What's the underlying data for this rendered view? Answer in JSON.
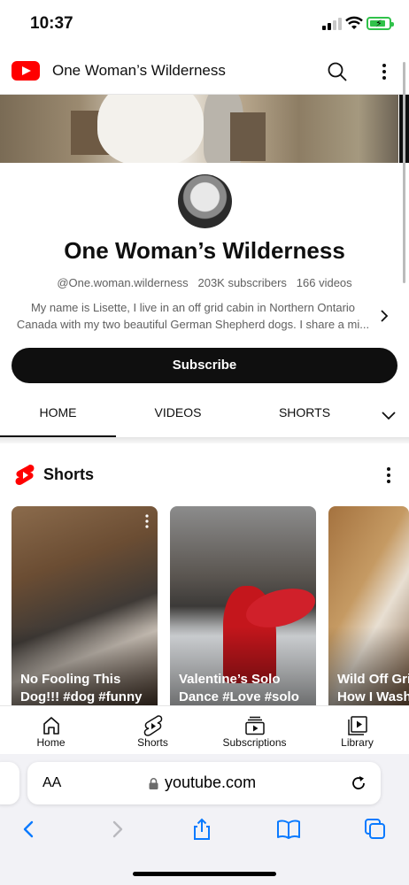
{
  "status_bar": {
    "time": "10:37"
  },
  "app_bar": {
    "title": "One Woman’s Wilderness"
  },
  "channel": {
    "name": "One Woman’s Wilderness",
    "handle": "@One.woman.wilderness",
    "subscribers": "203K subscribers",
    "videos": "166 videos",
    "description_line1": "My name is Lisette, I live in an off grid cabin in Northern Ontario",
    "description_line2": "Canada with my two beautiful German Shepherd dogs. I share a mi...",
    "subscribe_label": "Subscribe"
  },
  "tabs": [
    {
      "label": "HOME",
      "active": true
    },
    {
      "label": "VIDEOS",
      "active": false
    },
    {
      "label": "SHORTS",
      "active": false
    }
  ],
  "shorts_shelf": {
    "title": "Shorts",
    "items": [
      {
        "line1": "No Fooling This",
        "line2": "Dog!!! #dog #funny"
      },
      {
        "line1": "Valentine’s Solo",
        "line2": "Dance #Love #solo"
      },
      {
        "line1": "Wild Off Gri",
        "line2": "How I Wash"
      }
    ]
  },
  "bottom_nav": [
    {
      "label": "Home",
      "icon": "home-icon"
    },
    {
      "label": "Shorts",
      "icon": "shorts-icon"
    },
    {
      "label": "Subscriptions",
      "icon": "subscriptions-icon"
    },
    {
      "label": "Library",
      "icon": "library-icon"
    }
  ],
  "browser": {
    "text_size_label": "AA",
    "url": "youtube.com"
  },
  "colors": {
    "brand_red": "#ff0000",
    "battery_green": "#30c24a",
    "text_primary": "#0f0f0f",
    "text_secondary": "#606060"
  }
}
